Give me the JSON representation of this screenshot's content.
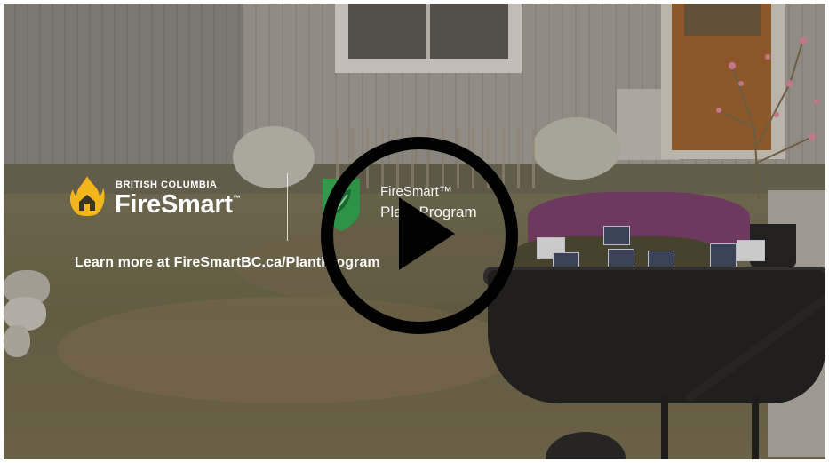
{
  "overlay": {
    "brand_small": "BRITISH COLUMBIA",
    "brand_big": "FireSmart",
    "trademark": "™",
    "program_line1": "FireSmart™",
    "program_line2": "Plant Program",
    "learn_more": "Learn more at FireSmartBC.ca/PlantProgram"
  },
  "player": {
    "play_button": "play-icon"
  },
  "colors": {
    "logo_flame": "#f2b51c",
    "shield_green": "#2e9a4a",
    "play_ring": "#000000",
    "text": "#ffffff"
  },
  "icons": [
    "flame-house-icon",
    "leaf-shield-icon",
    "play-icon"
  ]
}
